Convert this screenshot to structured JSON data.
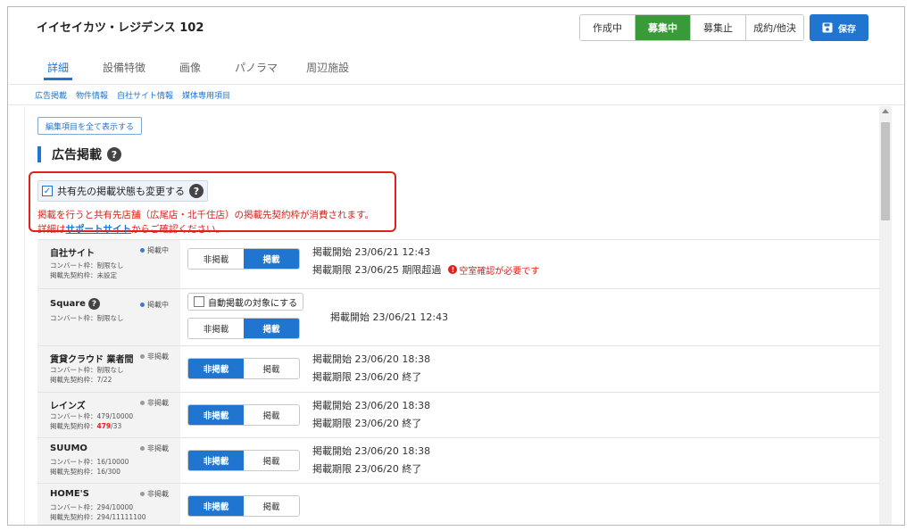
{
  "header": {
    "title": "イイセイカツ・レジデンス 102",
    "status_buttons": [
      {
        "label": "作成中",
        "active": false
      },
      {
        "label": "募集中",
        "active": true
      },
      {
        "label": "募集止",
        "active": false
      },
      {
        "label": "成約/他決",
        "active": false
      }
    ],
    "save_label": "保存",
    "accent_color": "#1f75d0",
    "active_status_color": "#3a9a3a"
  },
  "tabs": [
    {
      "label": "詳細",
      "active": true
    },
    {
      "label": "設備特徴",
      "active": false
    },
    {
      "label": "画像",
      "active": false
    },
    {
      "label": "パノラマ",
      "active": false
    },
    {
      "label": "周辺施設",
      "active": false
    }
  ],
  "subnav": [
    "広告掲載",
    "物件情報",
    "自社サイト情報",
    "媒体専用項目"
  ],
  "main": {
    "show_all_label": "編集項目を全て表示する",
    "section_title": "広告掲載",
    "share_checkbox_label": "共有先の掲載状態も変更する",
    "share_checked": true,
    "warning_line1": "掲載を行うと共有先店舗（広尾店・北千住店）の掲載先契約枠が消費されます。",
    "warning_line2_prefix": "詳細は",
    "warning_link": "サポートサイト",
    "warning_line2_suffix": "からご確認ください。"
  },
  "media_rows": [
    {
      "name": "自社サイト",
      "has_help": false,
      "status": "掲載中",
      "status_color": "#3a7ad6",
      "meta1": "コンバート枠：制限なし",
      "meta2": "掲載先契約枠：未設定",
      "meta2_red": "",
      "meta2_suffix": "",
      "off_label": "非掲載",
      "on_label": "掲載",
      "posted": true,
      "auto_label": "",
      "line1": "掲載開始 23/06/21 12:43",
      "line2": "掲載期限 23/06/25 期限超過",
      "alert": "空室確認が必要です"
    },
    {
      "name": "Square",
      "has_help": true,
      "status": "掲載中",
      "status_color": "#3a7ad6",
      "meta1": "コンバート枠：制限なし",
      "meta2": "",
      "meta2_red": "",
      "meta2_suffix": "",
      "off_label": "非掲載",
      "on_label": "掲載",
      "posted": true,
      "auto_label": "自動掲載の対象にする",
      "line1": "掲載開始 23/06/21 12:43",
      "line2": "",
      "alert": ""
    },
    {
      "name": "賃貸クラウド 業者間",
      "has_help": false,
      "status": "非掲載",
      "status_color": "#999999",
      "meta1": "コンバート枠：制限なし",
      "meta2": "掲載先契約枠：7/22",
      "meta2_red": "",
      "meta2_suffix": "",
      "off_label": "非掲載",
      "on_label": "掲載",
      "posted": false,
      "auto_label": "",
      "line1": "掲載開始 23/06/20 18:38",
      "line2": "掲載期限 23/06/20 終了",
      "alert": ""
    },
    {
      "name": "レインズ",
      "has_help": false,
      "status": "非掲載",
      "status_color": "#999999",
      "meta1": "コンバート枠：479/10000",
      "meta2": "掲載先契約枠：",
      "meta2_red": "479",
      "meta2_suffix": "/33",
      "off_label": "非掲載",
      "on_label": "掲載",
      "posted": false,
      "auto_label": "",
      "line1": "掲載開始 23/06/20 18:38",
      "line2": "掲載期限 23/06/20 終了",
      "alert": ""
    },
    {
      "name": "SUUMO",
      "has_help": false,
      "status": "非掲載",
      "status_color": "#999999",
      "meta1": "コンバート枠：16/10000",
      "meta2": "掲載先契約枠：16/300",
      "meta2_red": "",
      "meta2_suffix": "",
      "off_label": "非掲載",
      "on_label": "掲載",
      "posted": false,
      "auto_label": "",
      "line1": "掲載開始 23/06/20 18:38",
      "line2": "掲載期限 23/06/20 終了",
      "alert": ""
    },
    {
      "name": "HOME'S",
      "has_help": false,
      "status": "非掲載",
      "status_color": "#999999",
      "meta1": "コンバート枠：294/10000",
      "meta2": "掲載先契約枠：294/11111100",
      "meta2_red": "",
      "meta2_suffix": "",
      "off_label": "非掲載",
      "on_label": "掲載",
      "posted": false,
      "auto_label": "",
      "line1": "",
      "line2": "",
      "alert": ""
    }
  ]
}
